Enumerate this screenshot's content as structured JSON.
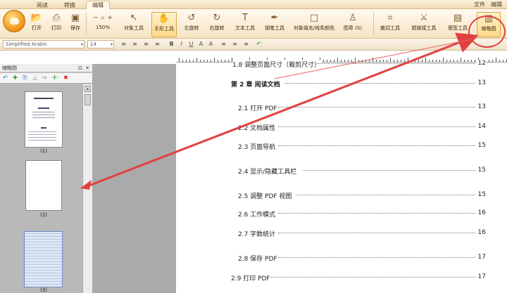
{
  "tabs": [
    "阅读",
    "转换",
    "编辑"
  ],
  "menu_right": [
    "文件",
    "编辑"
  ],
  "tools": [
    {
      "label": "打开",
      "icon": "folder-open-icon",
      "glyph": "📂"
    },
    {
      "label": "打印",
      "icon": "printer-icon",
      "glyph": "⎙"
    },
    {
      "label": "保存",
      "icon": "save-icon",
      "glyph": "💾"
    },
    {
      "label": "150%",
      "icon": "zoom-icon",
      "glyph": "− 🔍 +"
    },
    {
      "label": "对象工具",
      "icon": "pointer-icon",
      "glyph": "↖"
    },
    {
      "label": "手形工具",
      "icon": "hand-icon",
      "glyph": "✋"
    },
    {
      "label": "左旋转",
      "icon": "rotate-left-icon",
      "glyph": "↺"
    },
    {
      "label": "右旋转",
      "icon": "rotate-right-icon",
      "glyph": "↻"
    },
    {
      "label": "文本工具",
      "icon": "text-tool-icon",
      "glyph": "T"
    },
    {
      "label": "钢笔工具",
      "icon": "pen-icon",
      "glyph": "✒"
    },
    {
      "label": "对象填充/线条颜色",
      "icon": "fill-color-icon",
      "glyph": "□"
    },
    {
      "label": "图章 (S)",
      "icon": "stamp-icon",
      "glyph": "♙"
    },
    {
      "label": "裁切工具",
      "icon": "crop-icon",
      "glyph": "⌗"
    },
    {
      "label": "超链接工具",
      "icon": "link-icon",
      "glyph": "🔗"
    },
    {
      "label": "便签工具",
      "icon": "note-icon",
      "glyph": "🗒"
    },
    {
      "label": "缩略图",
      "icon": "thumbnail-icon",
      "glyph": "▤"
    }
  ],
  "format": {
    "font": "Simplified Arabic",
    "size": "14",
    "buttons": [
      "≡",
      "≡",
      "≡",
      "≡",
      "B",
      "I",
      "U",
      "A",
      "A",
      "≡",
      "≡",
      "≡",
      "↶"
    ]
  },
  "thumb_panel": {
    "title": "缩略图",
    "close": "✕",
    "pin": "⊡",
    "pages": [
      "(1)",
      "(2)",
      "(3)"
    ]
  },
  "toc": [
    {
      "title": "1.8 调整页面尺寸（裁剪尺寸）",
      "page": "12",
      "chapter": false
    },
    {
      "title": "第 2 章 阅读文档",
      "page": "13",
      "chapter": true
    },
    {
      "title": "2.1 打开 PDF",
      "page": "13",
      "chapter": false
    },
    {
      "title": "2.2 文档属性",
      "page": "14",
      "chapter": false
    },
    {
      "title": "2.3 页面导航",
      "page": "15",
      "chapter": false
    },
    {
      "title": "2.4 显示/隐藏工具栏",
      "page": "15",
      "chapter": false
    },
    {
      "title": "2.5 调整 PDF 视图",
      "page": "15",
      "chapter": false
    },
    {
      "title": "2.6 工作模式",
      "page": "16",
      "chapter": false
    },
    {
      "title": "2.7 字数统计",
      "page": "16",
      "chapter": false
    },
    {
      "title": "2.8 保存 PDF",
      "page": "17",
      "chapter": false
    },
    {
      "title": "2.9 打印 PDF",
      "page": "17",
      "chapter": false
    }
  ],
  "colors": {
    "annotation": "#e14040",
    "ribbon": "#f6e4c4",
    "selected_tool": "#ffd98a"
  }
}
